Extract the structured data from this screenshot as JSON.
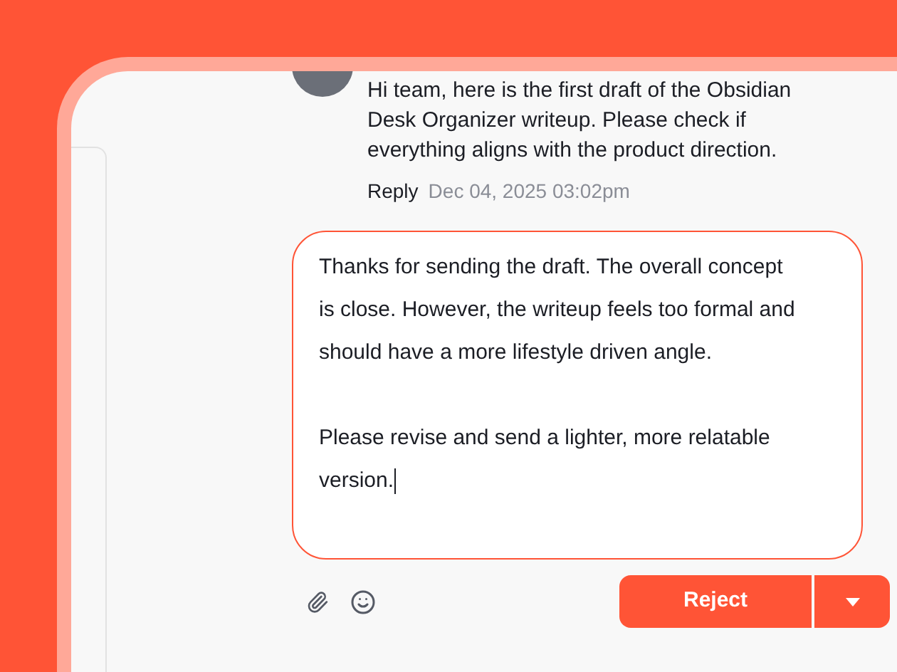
{
  "message": {
    "text": "Hi team, here is the first draft of the Obsidian Desk Organizer writeup. Please check if everything aligns with the product direction.",
    "reply_label": "Reply",
    "timestamp": "Dec 04, 2025 03:02pm"
  },
  "reply_field": {
    "value": "Thanks for sending the draft. The overall concept is close. However, the writeup feels too formal and should have a more lifestyle driven angle.\n\nPlease revise and send a lighter, more relatable version.",
    "focused": true
  },
  "actions": {
    "primary": "Reject"
  }
}
